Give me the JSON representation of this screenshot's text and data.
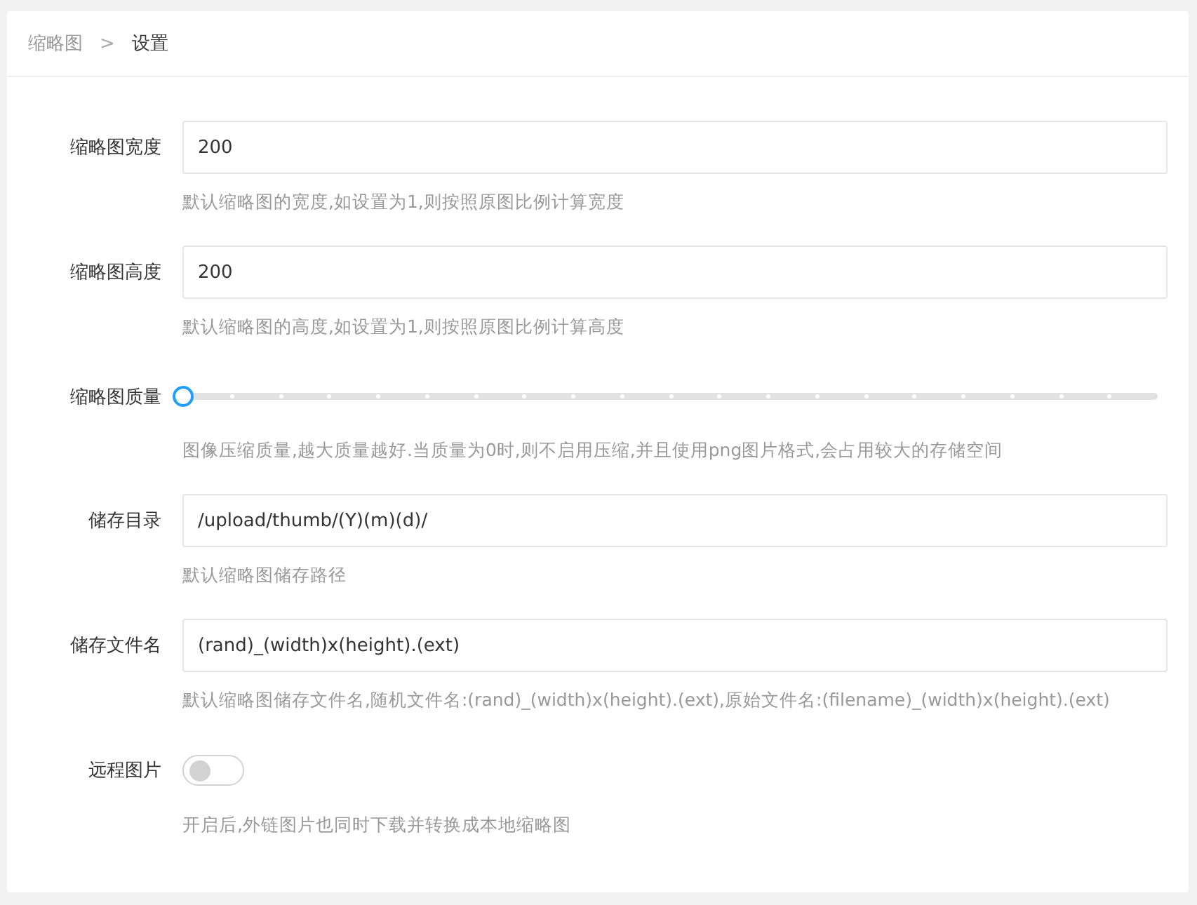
{
  "breadcrumb": [
    {
      "label": "缩略图",
      "current": false
    },
    {
      "label": "设置",
      "current": true
    }
  ],
  "breadcrumb_separator": ">",
  "fields": [
    {
      "kind": "text",
      "label": "缩略图宽度",
      "value": "200",
      "help": "默认缩略图的宽度,如设置为1,则按照原图比例计算宽度"
    },
    {
      "kind": "text",
      "label": "缩略图高度",
      "value": "200",
      "help": "默认缩略图的高度,如设置为1,则按照原图比例计算高度"
    },
    {
      "kind": "slider",
      "label": "缩略图质量",
      "level": 0,
      "help": "图像压缩质量,越大质量越好.当质量为0时,则不启用压缩,并且使用png图片格式,会占用较大的存储空间"
    },
    {
      "kind": "text",
      "label": "储存目录",
      "value": "/upload/thumb/(Y)(m)(d)/",
      "help": "默认缩略图储存路径"
    },
    {
      "kind": "text",
      "label": "储存文件名",
      "value": "(rand)_(width)x(height).(ext)",
      "help": "默认缩略图储存文件名,随机文件名:(rand)_(width)x(height).(ext),原始文件名:(filename)_(width)x(height).(ext)"
    },
    {
      "kind": "switch",
      "label": "远程图片",
      "on": false,
      "help": "开启后,外链图片也同时下载并转换成本地缩略图"
    }
  ]
}
